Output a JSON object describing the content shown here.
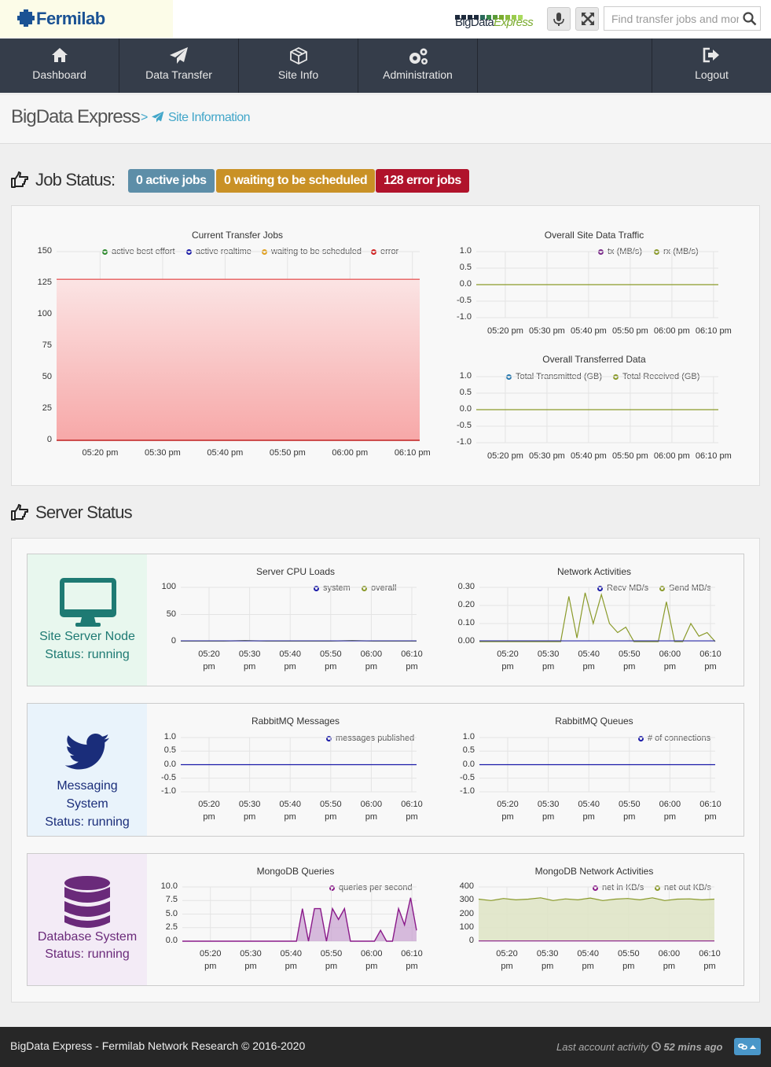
{
  "header": {
    "brand": "Fermilab",
    "product_logo": {
      "word1": "BigData",
      "word2": "Express"
    },
    "search_placeholder": "Find transfer jobs and more"
  },
  "nav": [
    {
      "label": "Dashboard",
      "icon": "home-icon"
    },
    {
      "label": "Data Transfer",
      "icon": "paper-plane-icon"
    },
    {
      "label": "Site Info",
      "icon": "cube-icon"
    },
    {
      "label": "Administration",
      "icon": "gears-icon"
    },
    {
      "label": "Logout",
      "icon": "sign-out-icon"
    }
  ],
  "breadcrumb": {
    "root": "BigData Express",
    "separator": ">",
    "current": "Site Information"
  },
  "job_status": {
    "heading": "Job Status:",
    "badges": [
      {
        "label": "0 active jobs",
        "color": "#5d8ea8"
      },
      {
        "label": "0 waiting to be scheduled",
        "color": "#c99126"
      },
      {
        "label": "128 error jobs",
        "color": "#b0132b"
      }
    ]
  },
  "server_status": {
    "heading": "Server Status"
  },
  "servers": [
    {
      "name_lines": [
        "Site Server Node",
        "Status: running"
      ],
      "color": "#1e7a73",
      "bg": "#e8f7ee",
      "icon": "desktop-icon"
    },
    {
      "name_lines": [
        "Messaging",
        "System",
        "Status: running"
      ],
      "color": "#1a2d7a",
      "bg": "#e9f3fb",
      "icon": "twitter-icon"
    },
    {
      "name_lines": [
        "Database System",
        "Status: running"
      ],
      "color": "#6a2a7a",
      "bg": "#f3ebf6",
      "icon": "database-icon"
    }
  ],
  "time_ticks": [
    "05:20 pm",
    "05:30 pm",
    "05:40 pm",
    "05:50 pm",
    "06:00 pm",
    "06:10 pm"
  ],
  "time_ticks_split": [
    [
      "05:20",
      "pm"
    ],
    [
      "05:30",
      "pm"
    ],
    [
      "05:40",
      "pm"
    ],
    [
      "05:50",
      "pm"
    ],
    [
      "06:00",
      "pm"
    ],
    [
      "06:10",
      "pm"
    ]
  ],
  "chart_data": [
    {
      "id": "current_transfer_jobs",
      "type": "area",
      "title": "Current Transfer Jobs",
      "yticks": [
        "150",
        "125",
        "100",
        "75",
        "50",
        "25",
        "0"
      ],
      "ylim": [
        0,
        150
      ],
      "legend": [
        {
          "name": "active best effort",
          "color": "#2e8b2e"
        },
        {
          "name": "active realtime",
          "color": "#1a1aa8"
        },
        {
          "name": "waiting to be scheduled",
          "color": "#e0a020"
        },
        {
          "name": "error",
          "color": "#d02020"
        }
      ],
      "series": [
        {
          "name": "error",
          "values": [
            128,
            128,
            128,
            128,
            128,
            128,
            128
          ]
        }
      ]
    },
    {
      "id": "overall_site_data_traffic",
      "type": "line",
      "title": "Overall Site Data Traffic",
      "yticks": [
        "1.0",
        "0.5",
        "0.0",
        "-0.5",
        "-1.0"
      ],
      "ylim": [
        -1,
        1
      ],
      "legend": [
        {
          "name": "tx (MB/s)",
          "color": "#7a2a8a"
        },
        {
          "name": "rx (MB/s)",
          "color": "#8a9a2a"
        }
      ],
      "series": [
        {
          "name": "rx (MB/s)",
          "values": [
            0,
            0,
            0,
            0,
            0,
            0,
            0
          ]
        }
      ]
    },
    {
      "id": "overall_transferred_data",
      "type": "line",
      "title": "Overall Transferred Data",
      "yticks": [
        "1.0",
        "0.5",
        "0.0",
        "-0.5",
        "-1.0"
      ],
      "ylim": [
        -1,
        1
      ],
      "legend": [
        {
          "name": "Total Transmitted (GB)",
          "color": "#2a7ab0"
        },
        {
          "name": "Total Received (GB)",
          "color": "#8a9a2a"
        }
      ],
      "series": [
        {
          "name": "Total Received (GB)",
          "values": [
            0,
            0,
            0,
            0,
            0,
            0,
            0
          ]
        }
      ]
    },
    {
      "id": "server_cpu_loads",
      "type": "line",
      "title": "Server CPU Loads",
      "yticks": [
        "100",
        "50",
        "0"
      ],
      "ylim": [
        0,
        100
      ],
      "legend": [
        {
          "name": "system",
          "color": "#1a1aa8"
        },
        {
          "name": "overall",
          "color": "#8a9a2a"
        }
      ],
      "series": [
        {
          "name": "overall",
          "values": [
            1,
            1,
            1,
            2,
            1,
            1,
            1,
            1,
            2,
            1,
            1,
            1
          ]
        }
      ]
    },
    {
      "id": "network_activities",
      "type": "line",
      "title": "Network Activities",
      "yticks": [
        "0.30",
        "0.20",
        "0.10",
        "0.00"
      ],
      "ylim": [
        0,
        0.3
      ],
      "legend": [
        {
          "name": "Recv MB/s",
          "color": "#1a1aa8"
        },
        {
          "name": "Send MB/s",
          "color": "#8a9a2a"
        }
      ],
      "series": [
        {
          "name": "Send MB/s",
          "values": [
            0,
            0,
            0,
            0,
            0,
            0,
            0,
            0,
            0,
            0,
            0,
            0.25,
            0.02,
            0.27,
            0.1,
            0.26,
            0.1,
            0.05,
            0.08,
            0,
            0,
            0,
            0,
            0.22,
            0,
            0,
            0.1,
            0.03,
            0.05,
            0
          ]
        }
      ]
    },
    {
      "id": "rabbitmq_messages",
      "type": "line",
      "title": "RabbitMQ Messages",
      "yticks": [
        "1.0",
        "0.5",
        "0.0",
        "-0.5",
        "-1.0"
      ],
      "ylim": [
        -1,
        1
      ],
      "legend": [
        {
          "name": "messages published",
          "color": "#1a1aa8"
        }
      ],
      "series": [
        {
          "name": "messages published",
          "values": [
            0,
            0,
            0,
            0,
            0,
            0,
            0
          ]
        }
      ]
    },
    {
      "id": "rabbitmq_queues",
      "type": "line",
      "title": "RabbitMQ Queues",
      "yticks": [
        "1.0",
        "0.5",
        "0.0",
        "-0.5",
        "-1.0"
      ],
      "ylim": [
        -1,
        1
      ],
      "legend": [
        {
          "name": "# of connections",
          "color": "#1a1aa8"
        }
      ],
      "series": [
        {
          "name": "# of connections",
          "values": [
            0,
            0,
            0,
            0,
            0,
            0,
            0
          ]
        }
      ]
    },
    {
      "id": "mongodb_queries",
      "type": "line",
      "title": "MongoDB Queries",
      "yticks": [
        "10.0",
        "7.5",
        "5.0",
        "2.5",
        "0.0"
      ],
      "ylim": [
        0,
        10
      ],
      "legend": [
        {
          "name": "queries per second",
          "color": "#8a1a8a"
        }
      ],
      "series": [
        {
          "name": "queries per second",
          "values": [
            0,
            0,
            0,
            0,
            0,
            0,
            0,
            0,
            0,
            0,
            0,
            0,
            0,
            0,
            0,
            0,
            0,
            0,
            0,
            0,
            6,
            0,
            6,
            6,
            0,
            6,
            4,
            6,
            0,
            0,
            0,
            0,
            0,
            2,
            0,
            0,
            6,
            3,
            8,
            2
          ]
        }
      ]
    },
    {
      "id": "mongodb_network_activities",
      "type": "area",
      "title": "MongoDB Network Activities",
      "yticks": [
        "400",
        "300",
        "200",
        "100",
        "0"
      ],
      "ylim": [
        0,
        400
      ],
      "legend": [
        {
          "name": "net in KB/s",
          "color": "#8a1a8a"
        },
        {
          "name": "net out KB/s",
          "color": "#8a9a2a"
        }
      ],
      "series": [
        {
          "name": "net out KB/s",
          "values": [
            310,
            300,
            315,
            305,
            310,
            320,
            300,
            312,
            305,
            318,
            300,
            310,
            315,
            305,
            320,
            300,
            310,
            312,
            305,
            310
          ]
        },
        {
          "name": "net in KB/s",
          "values": [
            2,
            2,
            2,
            2,
            2,
            2,
            2,
            2,
            2,
            2,
            2,
            2,
            2,
            2,
            2,
            2,
            2,
            2,
            2,
            2
          ]
        }
      ]
    }
  ],
  "footer": {
    "copyright": "BigData Express - Fermilab Network Research © 2016-2020",
    "activity_label": "Last account activity",
    "activity_value": "52 mins ago"
  }
}
